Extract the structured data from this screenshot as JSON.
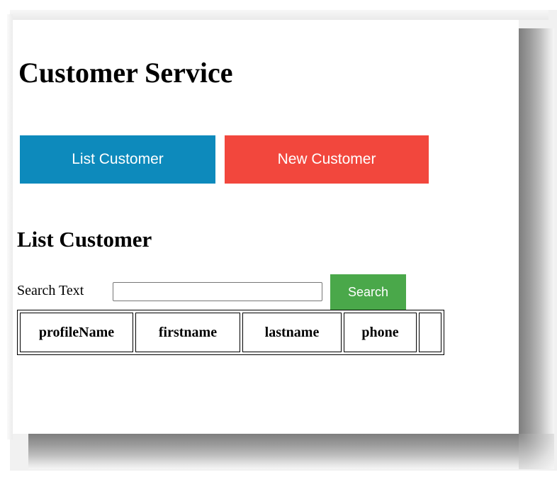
{
  "page": {
    "title": "Customer Service"
  },
  "nav": {
    "list_label": "List Customer",
    "new_label": "New Customer",
    "list_color": "#0d8abc",
    "new_color": "#f2473d"
  },
  "section": {
    "title": "List Customer"
  },
  "search": {
    "label": "Search Text",
    "value": "",
    "placeholder": "",
    "button_label": "Search",
    "button_color": "#4aa84a"
  },
  "table": {
    "columns": [
      "profileName",
      "firstname",
      "lastname",
      "phone",
      ""
    ],
    "rows": []
  }
}
